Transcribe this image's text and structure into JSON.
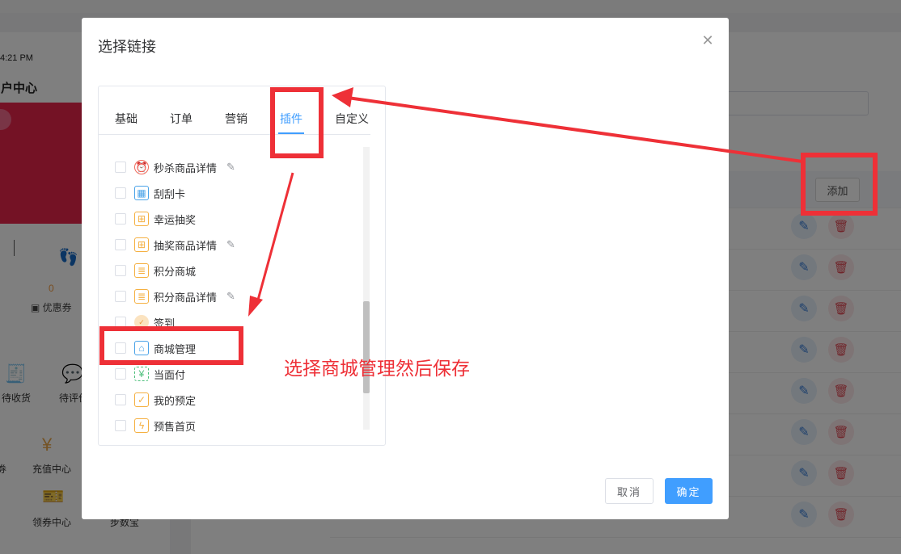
{
  "background": {
    "time": "4:21 PM",
    "title": "用户中心",
    "coupon_count": "0",
    "coupon_label": "优惠券",
    "icons": [
      {
        "label": "待收货",
        "icon": "receipt-icon"
      },
      {
        "label": "待评价",
        "icon": "comment-icon"
      },
      {
        "label": "充值中心",
        "icon": "yuan-coin-icon"
      },
      {
        "label": "领券中心",
        "icon": "ticket-icon"
      },
      {
        "label": "券",
        "icon": ""
      },
      {
        "label": "步数宝",
        "icon": ""
      }
    ],
    "add_button": "添加"
  },
  "modal": {
    "title": "选择链接",
    "tabs": [
      {
        "label": "基础"
      },
      {
        "label": "订单"
      },
      {
        "label": "营销"
      },
      {
        "label": "插件",
        "active": true
      },
      {
        "label": "自定义"
      }
    ],
    "items": [
      {
        "label": "秒杀商品详情",
        "icon": "alarm-clock-icon",
        "color": "#f06a5a",
        "editable": true
      },
      {
        "label": "刮刮卡",
        "icon": "scratch-card-icon",
        "color": "#4aa3e8",
        "editable": false
      },
      {
        "label": "幸运抽奖",
        "icon": "gift-icon",
        "color": "#f5b041",
        "editable": false
      },
      {
        "label": "抽奖商品详情",
        "icon": "gift-icon",
        "color": "#f5b041",
        "editable": true
      },
      {
        "label": "积分商城",
        "icon": "points-mall-icon",
        "color": "#f5b041",
        "editable": false
      },
      {
        "label": "积分商品详情",
        "icon": "points-mall-icon",
        "color": "#f5b041",
        "editable": true
      },
      {
        "label": "签到",
        "icon": "sign-in-icon",
        "color": "#f5b041",
        "editable": false
      },
      {
        "label": "商城管理",
        "icon": "store-manage-icon",
        "color": "#4aa3e8",
        "editable": false
      },
      {
        "label": "当面付",
        "icon": "scan-pay-icon",
        "color": "#4cbf7a",
        "editable": false
      },
      {
        "label": "我的预定",
        "icon": "reservation-icon",
        "color": "#f5b041",
        "editable": false
      },
      {
        "label": "预售首页",
        "icon": "presale-icon",
        "color": "#f5b041",
        "editable": false
      }
    ],
    "cancel_label": "取消",
    "confirm_label": "确定"
  },
  "annotation": {
    "text": "选择商城管理然后保存",
    "color": "#ee3037"
  },
  "colors": {
    "primary": "#409eff",
    "annotation_red": "#ee3037"
  }
}
